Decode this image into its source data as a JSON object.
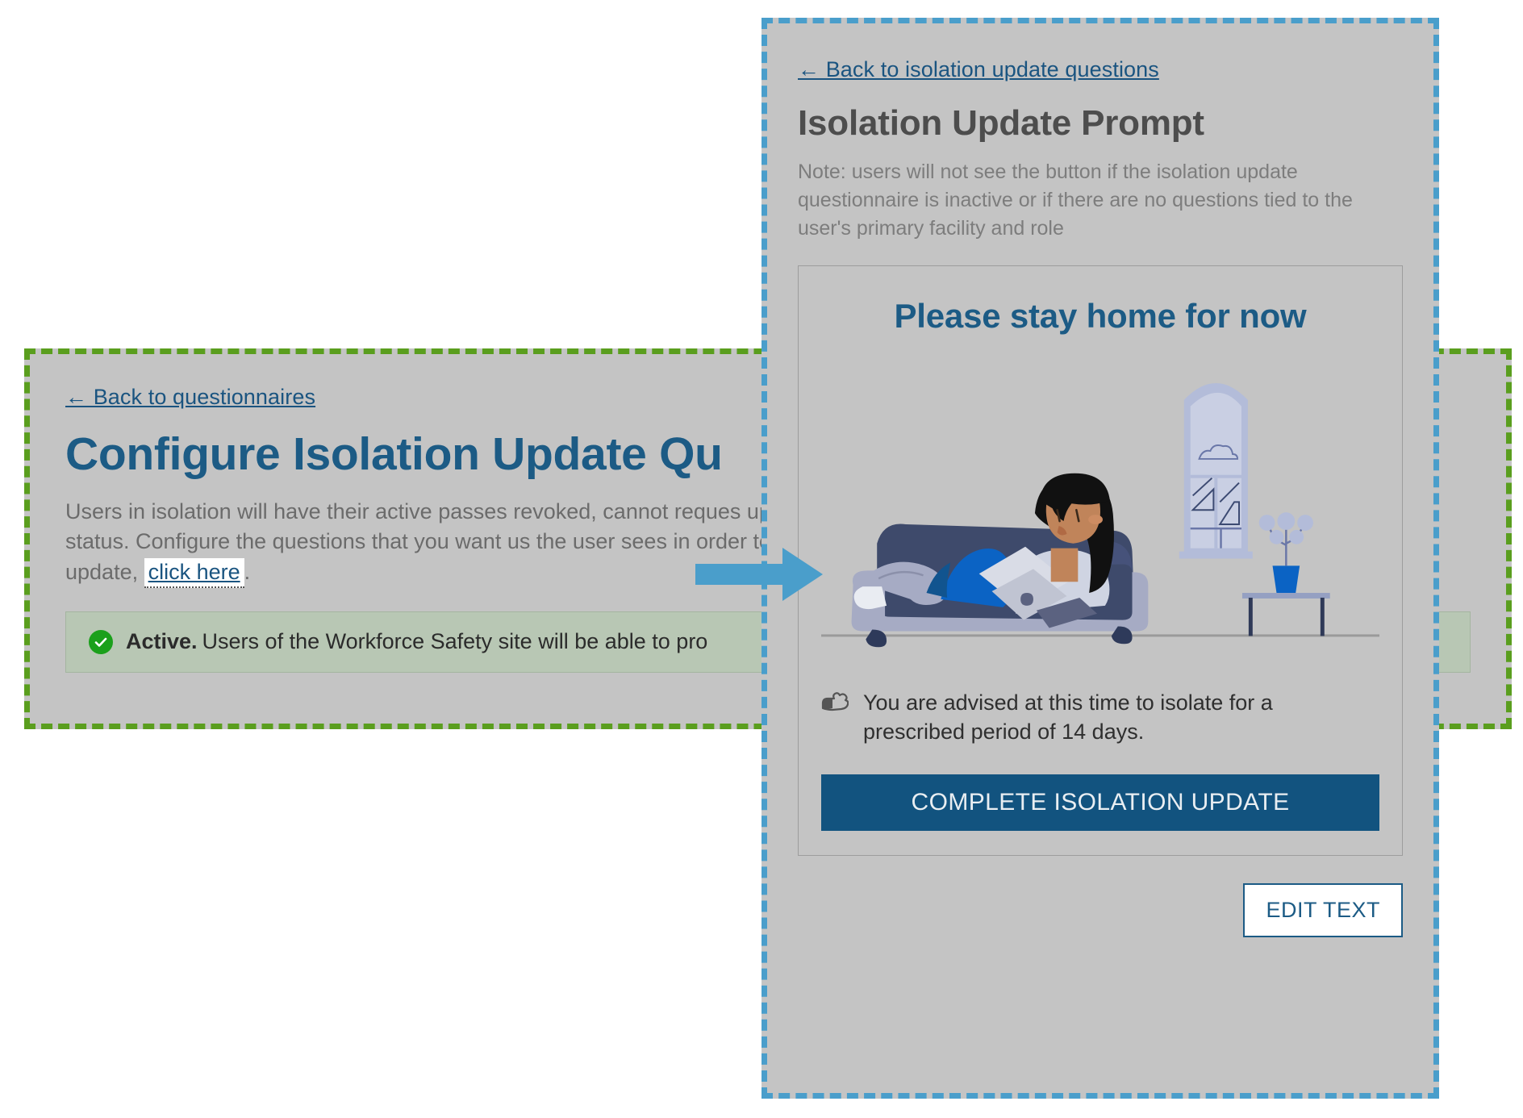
{
  "colors": {
    "panel_bg": "#c4c4c4",
    "left_border": "#5a9e1e",
    "right_border": "#4a9ecb",
    "brand_blue": "#1c5b85",
    "link_blue": "#1a5480",
    "button_blue": "#12537f",
    "arrow_blue": "#4a9ecb",
    "active_banner_bg": "#b8c7b4",
    "active_check_green": "#1ba01b",
    "body_gray": "#6b6b6b"
  },
  "left_panel": {
    "back_link": "← Back to questionnaires",
    "title": "Configure Isolation Update Qu",
    "body_before_link": "Users in isolation will have their active passes revoked, cannot reques update to track their status. Configure the questions that you want us the user sees in order to begin an isolation update, ",
    "link_text": "click here",
    "body_after_link": ".",
    "status_banner": {
      "icon": "check-circle-icon",
      "label": "Active.",
      "text": "Users of the Workforce Safety site will be able to pro"
    }
  },
  "right_panel": {
    "back_link": "← Back to isolation update questions",
    "title": "Isolation Update Prompt",
    "note": "Note: users will not see the button if the isolation update questionnaire is inactive or if there are no questions tied to the user's primary facility and role",
    "preview": {
      "heading": "Please stay home for now",
      "illustration_name": "person-reading-on-couch-illustration",
      "advice_icon": "pointing-hand-icon",
      "advice_text": "You are advised at this time to isolate for a prescribed period of 14 days.",
      "complete_button": "COMPLETE ISOLATION UPDATE"
    },
    "edit_button": "EDIT TEXT"
  }
}
